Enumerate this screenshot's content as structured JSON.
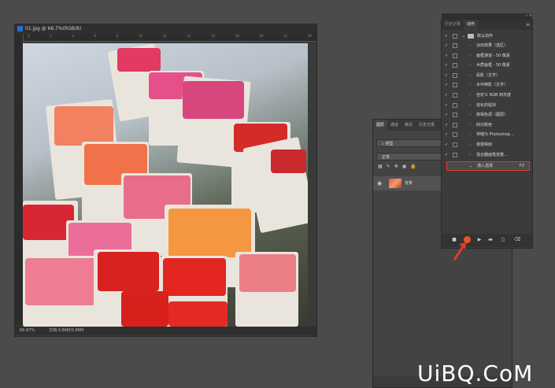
{
  "document": {
    "title": "01.jpg @ 66.7%(RGB/8)",
    "zoom": "66.67%",
    "doc_size": "文档:3.86M/3.86M",
    "ruler_ticks": [
      "0",
      "2",
      "4",
      "6",
      "8",
      "10",
      "12",
      "14",
      "16",
      "18",
      "20",
      "22",
      "24"
    ]
  },
  "layers_panel": {
    "tabs": [
      "图层",
      "通道",
      "路径",
      "历史记录"
    ],
    "active_tab": "图层",
    "kind_label": "类型",
    "mode_label": "正常",
    "layer_name": "背景"
  },
  "actions_panel": {
    "tabs": [
      "历史记录",
      "动作"
    ],
    "active_tab": "动作",
    "menu_icon": "≡",
    "set_name": "默认动作",
    "items": [
      "淡出效果（选区）",
      "画框通道 - 50 像素",
      "木质画框 - 50 像素",
      "投影（文字）",
      "水中倒影（文字）",
      "自定义 RGB 到灰度",
      "熔化的铅块",
      "棕褐色调（图层）",
      "四分颜色",
      "存储为 Photoshop...",
      "渐变映射",
      "混合器画笔克隆..."
    ],
    "selected_item": "通入选择",
    "selected_key": "F2"
  },
  "watermark": "UiBQ.CoM",
  "colors": {
    "highlight": "#e03a2f",
    "record": "#e8552a",
    "ps_blue": "#2d6bd2"
  }
}
